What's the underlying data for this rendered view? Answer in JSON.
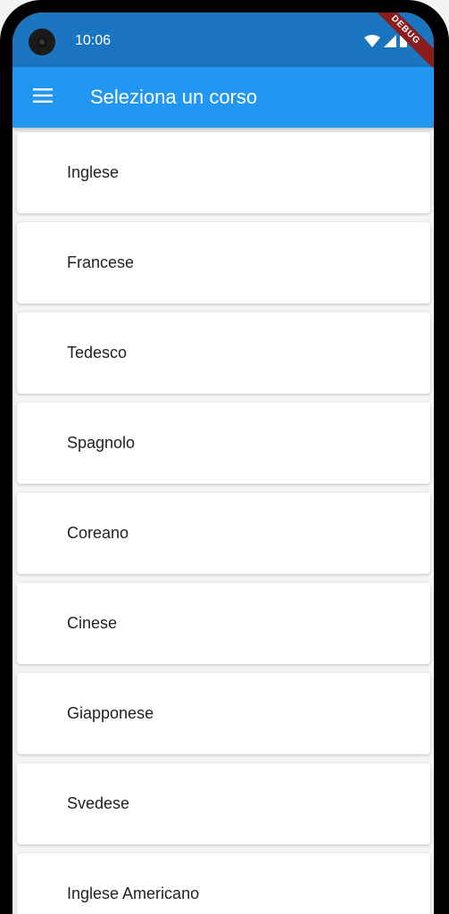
{
  "status_bar": {
    "time": "10:06",
    "debug_banner": "DEBUG",
    "color": "#1a74bf"
  },
  "app_bar": {
    "title": "Seleziona un corso",
    "menu_icon": "hamburger-menu-icon",
    "color": "#2196f3"
  },
  "courses": [
    {
      "label": "Inglese"
    },
    {
      "label": "Francese"
    },
    {
      "label": "Tedesco"
    },
    {
      "label": "Spagnolo"
    },
    {
      "label": "Coreano"
    },
    {
      "label": "Cinese"
    },
    {
      "label": "Giapponese"
    },
    {
      "label": "Svedese"
    },
    {
      "label": "Inglese Americano"
    }
  ]
}
